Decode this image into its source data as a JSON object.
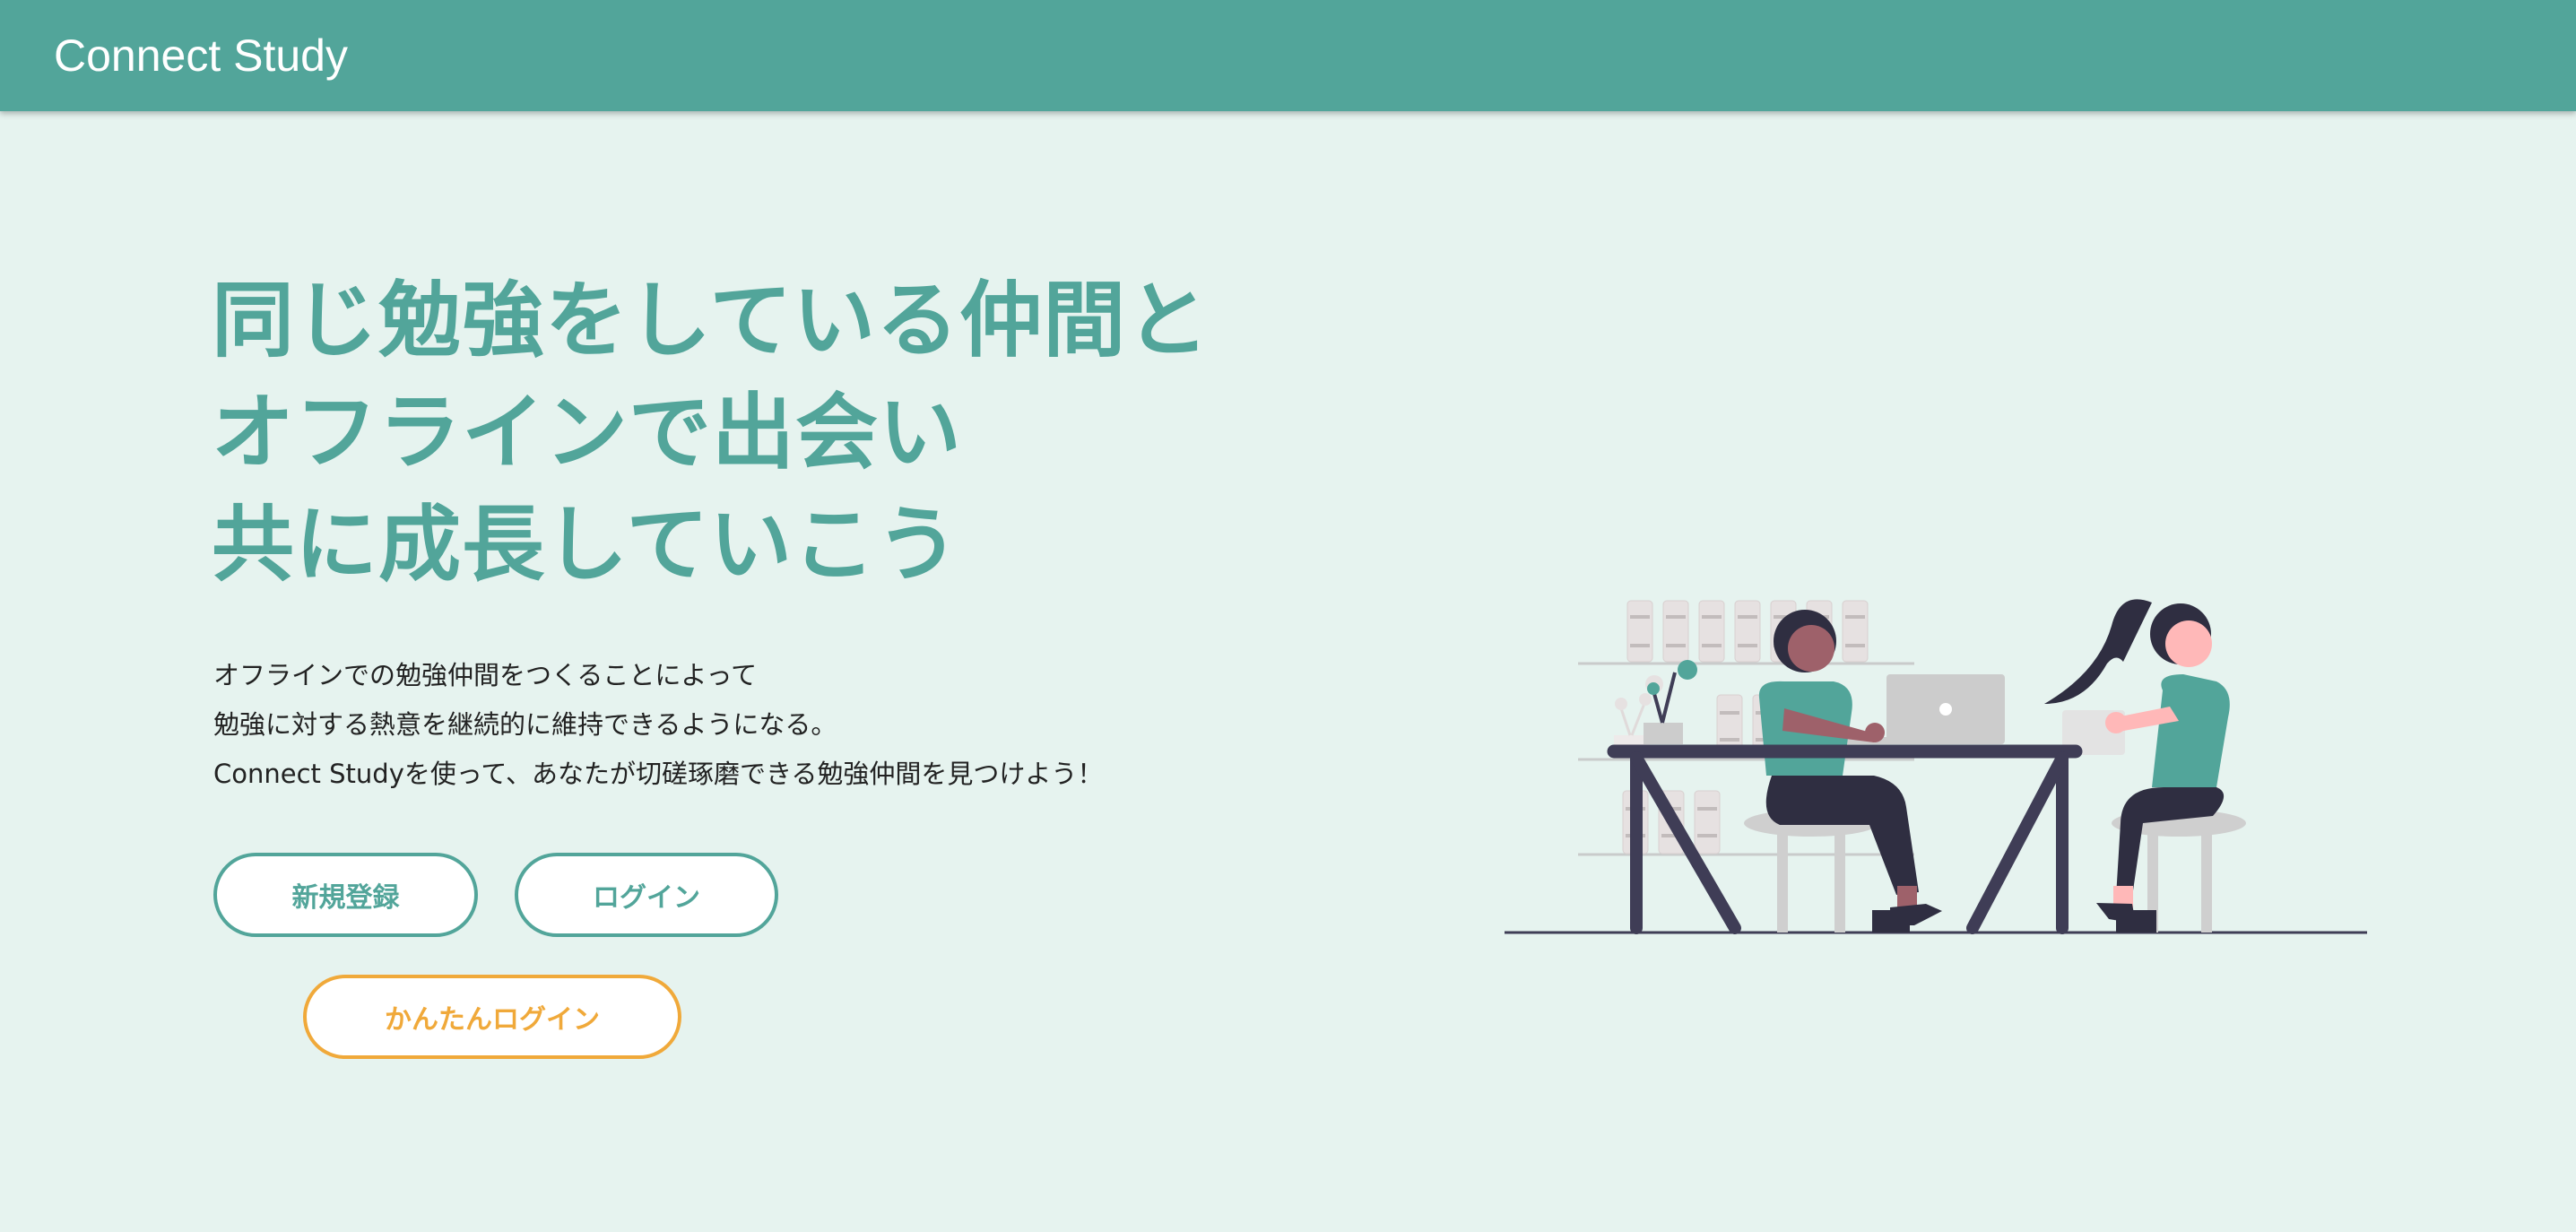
{
  "header": {
    "brand": "Connect Study",
    "background_color": "#52a59a"
  },
  "hero": {
    "title_lines": [
      "同じ勉強をしている仲間と",
      "オフラインで出会い",
      "共に成長していこう"
    ],
    "description_lines": [
      "オフラインでの勉強仲間をつくることによって",
      "勉強に対する熱意を継続的に維持できるようになる。",
      "Connect Studyを使って、あなたが切磋琢磨できる勉強仲間を見つけよう！"
    ],
    "accent_color": "#52a59a"
  },
  "buttons": {
    "register_label": "新規登録",
    "login_label": "ログイン",
    "easy_login_label": "かんたんログイン",
    "easy_login_color": "#f0a93a"
  },
  "page": {
    "background_color": "#e6f3ef"
  },
  "illustration": {
    "icon": "people-studying-at-desk-illustration"
  }
}
